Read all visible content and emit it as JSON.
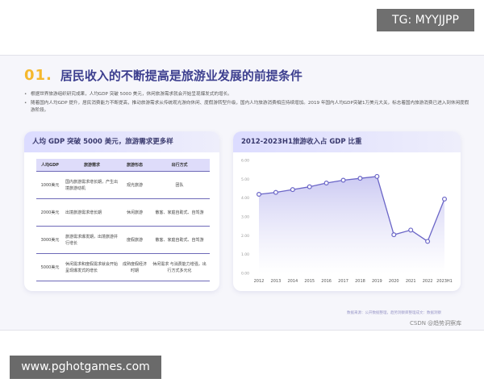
{
  "overlay": {
    "top_badge": "TG: MYYJJPP",
    "bottom_badge": "www.pghotgames.com"
  },
  "header": {
    "number": "01.",
    "title": "居民收入的不断提高是旅游业发展的前提条件"
  },
  "bullets": [
    "根据世界旅游组织研究成果，人均GDP 突破 5000 美元，休闲旅游需求就会开始呈现爆发式的增长。",
    "随着国内人均GDP 提升，居民消费能力不断提高，推动旅游需求从传统观光游向休闲、度假游转型升级，国内人均旅游消费相应持续增加。2019 年国内人均GDP突破1万美元大关，标志着国内旅游消费已进入到休闲度假游阶段。"
  ],
  "left_panel": {
    "title": "人均 GDP 突破 5000 美元，旅游需求更多样",
    "columns": [
      "人均GDP",
      "旅游需求",
      "旅游形态",
      "出行方式"
    ],
    "rows": [
      [
        "1000美元",
        "国内旅游需求增长期，产生出境旅游动机",
        "观光旅游",
        "团队"
      ],
      [
        "2000美元",
        "出境旅游需求增长期",
        "休闲旅游",
        "散客、家庭自助式、自驾游"
      ],
      [
        "3000美元",
        "旅游需求爆发期，出境旅游并行增长",
        "度假旅游",
        "散客、家庭自助式、自驾游"
      ],
      [
        "5000美元",
        "休闲需求和度假需求就会开始呈现爆发式的增长",
        "成熟度假经济时期",
        "休闲需求 与消费能力增强，出行方式多元化"
      ]
    ]
  },
  "right_panel": {
    "title": "2012-2023H1旅游收入占 GDP 比重"
  },
  "chart_data": {
    "type": "area",
    "categories": [
      "2012",
      "2013",
      "2014",
      "2015",
      "2016",
      "2017",
      "2018",
      "2019",
      "2020",
      "2021",
      "2022",
      "2023H1"
    ],
    "values": [
      4.2,
      4.3,
      4.45,
      4.6,
      4.8,
      4.95,
      5.05,
      5.15,
      2.05,
      2.3,
      1.7,
      3.95
    ],
    "ytick_labels": [
      "6.00",
      "5.00",
      "4.00",
      "3.00",
      "2.00",
      "1.00",
      "0.00"
    ],
    "ylim": [
      0,
      6
    ],
    "grid": false,
    "line_color": "#6b66c7",
    "fill_color": "#c9c7f2"
  },
  "footer": {
    "source": "数据来源：公开数据整理，趋势洞察库整理成文：数据洞察",
    "watermark": "CSDN @趋势洞察库"
  }
}
